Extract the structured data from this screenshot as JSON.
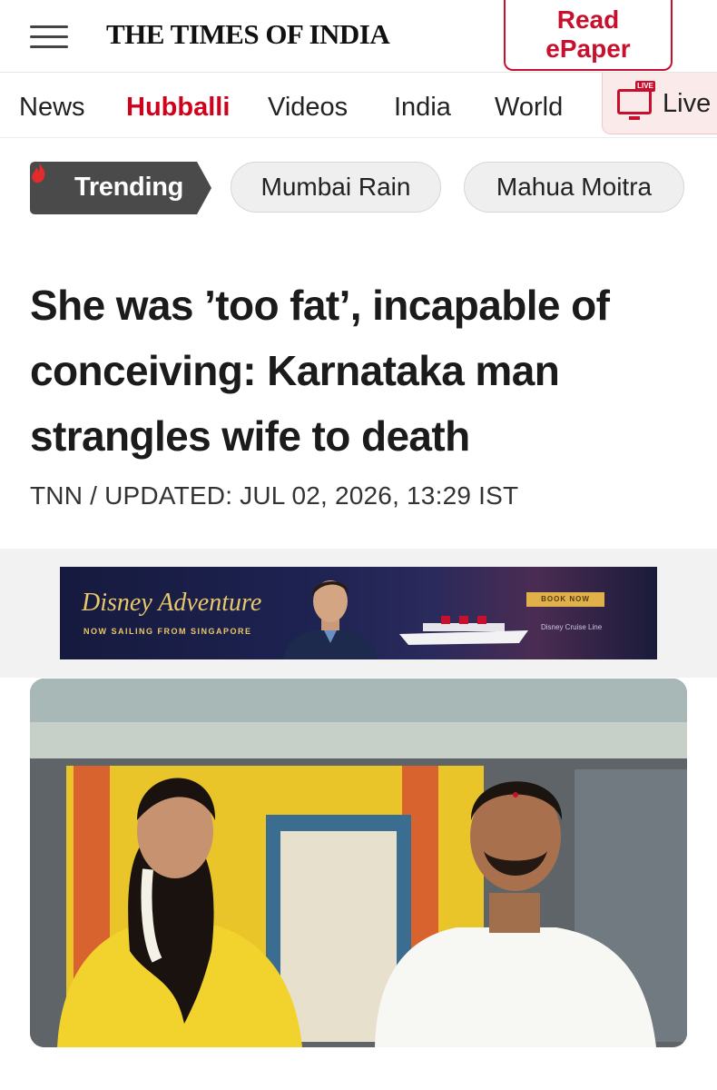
{
  "header": {
    "logo": "THE TIMES OF INDIA",
    "epaper_line1": "Read",
    "epaper_line2": "ePaper"
  },
  "nav": {
    "items": [
      "News",
      "Hubballi",
      "Videos",
      "India",
      "World"
    ],
    "active": "Hubballi",
    "live_label": "Live",
    "live_tag": "LIVE"
  },
  "trending": {
    "label": "Trending",
    "topics": [
      "Mumbai Rain",
      "Mahua Moitra"
    ]
  },
  "article": {
    "headline": "She was ’too fat’, incapable of conceiving: Karnataka man strangles wife to death",
    "byline": "TNN / UPDATED: JUL 02, 2026, 13:29 IST"
  },
  "ad": {
    "brand": "Disney Adventure",
    "tagline": "NOW SAILING FROM SINGAPORE",
    "cta": "BOOK NOW",
    "small": "Disney Cruise Line"
  },
  "colors": {
    "accent": "#c8102e",
    "nav_active": "#d0021b",
    "trending_bg": "#4a4a4a",
    "pill_bg": "#efefef"
  }
}
